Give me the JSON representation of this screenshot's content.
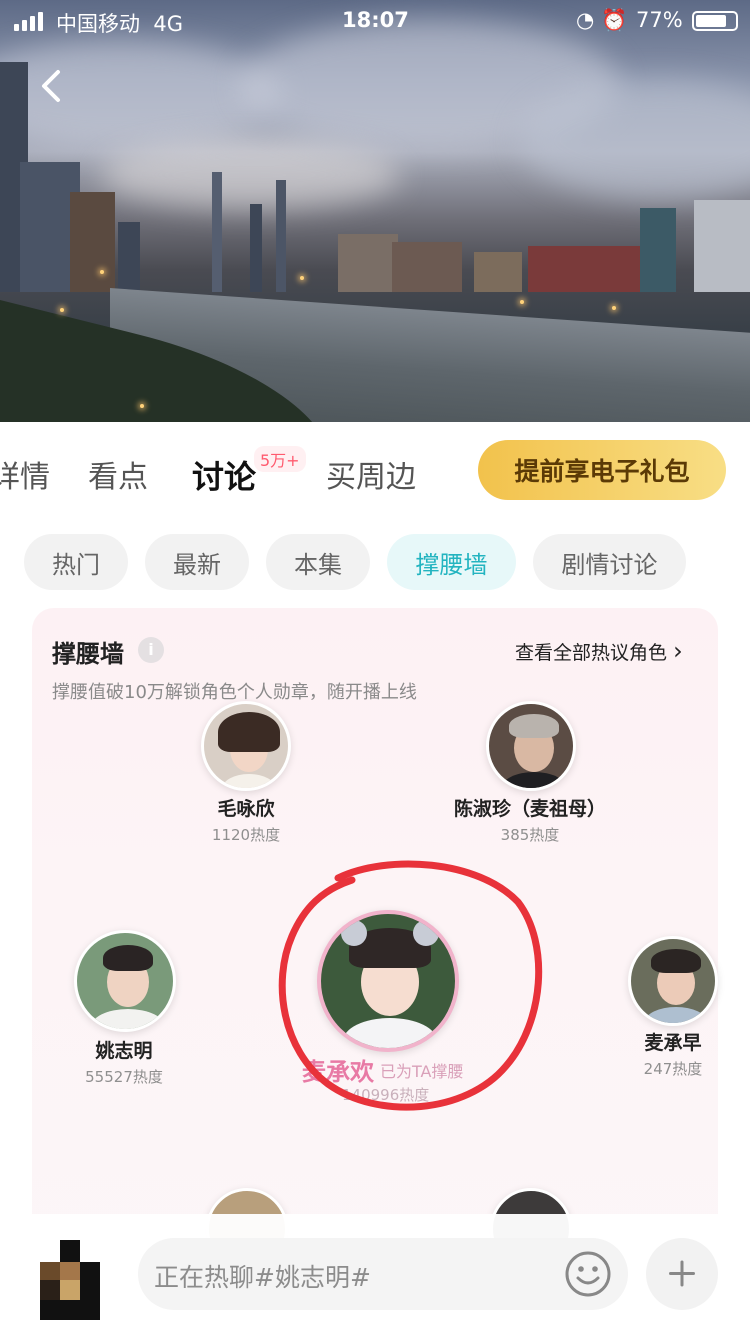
{
  "status_bar": {
    "carrier": "中国移动",
    "network": "4G",
    "time": "18:07",
    "status_icons": "◔ ⏰",
    "battery": "77%"
  },
  "tabs": [
    {
      "label": "详情"
    },
    {
      "label": "看点"
    },
    {
      "label": "讨论"
    },
    {
      "label": "买周边"
    }
  ],
  "active_tab_badge": "5万+",
  "gift_button": "提前享电子礼包",
  "filters": [
    "热门",
    "最新",
    "本集",
    "撑腰墙",
    "剧情讨论"
  ],
  "active_filter": "撑腰墙",
  "card": {
    "title": "撑腰墙",
    "info_icon": "i",
    "view_all": "查看全部热议角色",
    "view_all_arrow": "›",
    "subtitle": "撑腰值破10万解锁角色个人勋章，随开播上线"
  },
  "characters": [
    {
      "name": "毛咏欣",
      "heat": "1120热度"
    },
    {
      "name": "陈淑珍（麦祖母）",
      "heat": "385热度"
    },
    {
      "name": "姚志明",
      "heat": "55527热度"
    },
    {
      "name": "麦承欢",
      "heat": "140996热度",
      "tag": "已为TA撑腰"
    },
    {
      "name": "麦承早",
      "heat": "247热度"
    }
  ],
  "input": {
    "placeholder": "正在热聊#姚志明#"
  },
  "colors": {
    "accent": "#23b4c0",
    "badge": "#ff5a6e",
    "gift": "#f2c24c",
    "highlight_pink": "#e87aa5",
    "annotation_red": "#e8323a"
  }
}
